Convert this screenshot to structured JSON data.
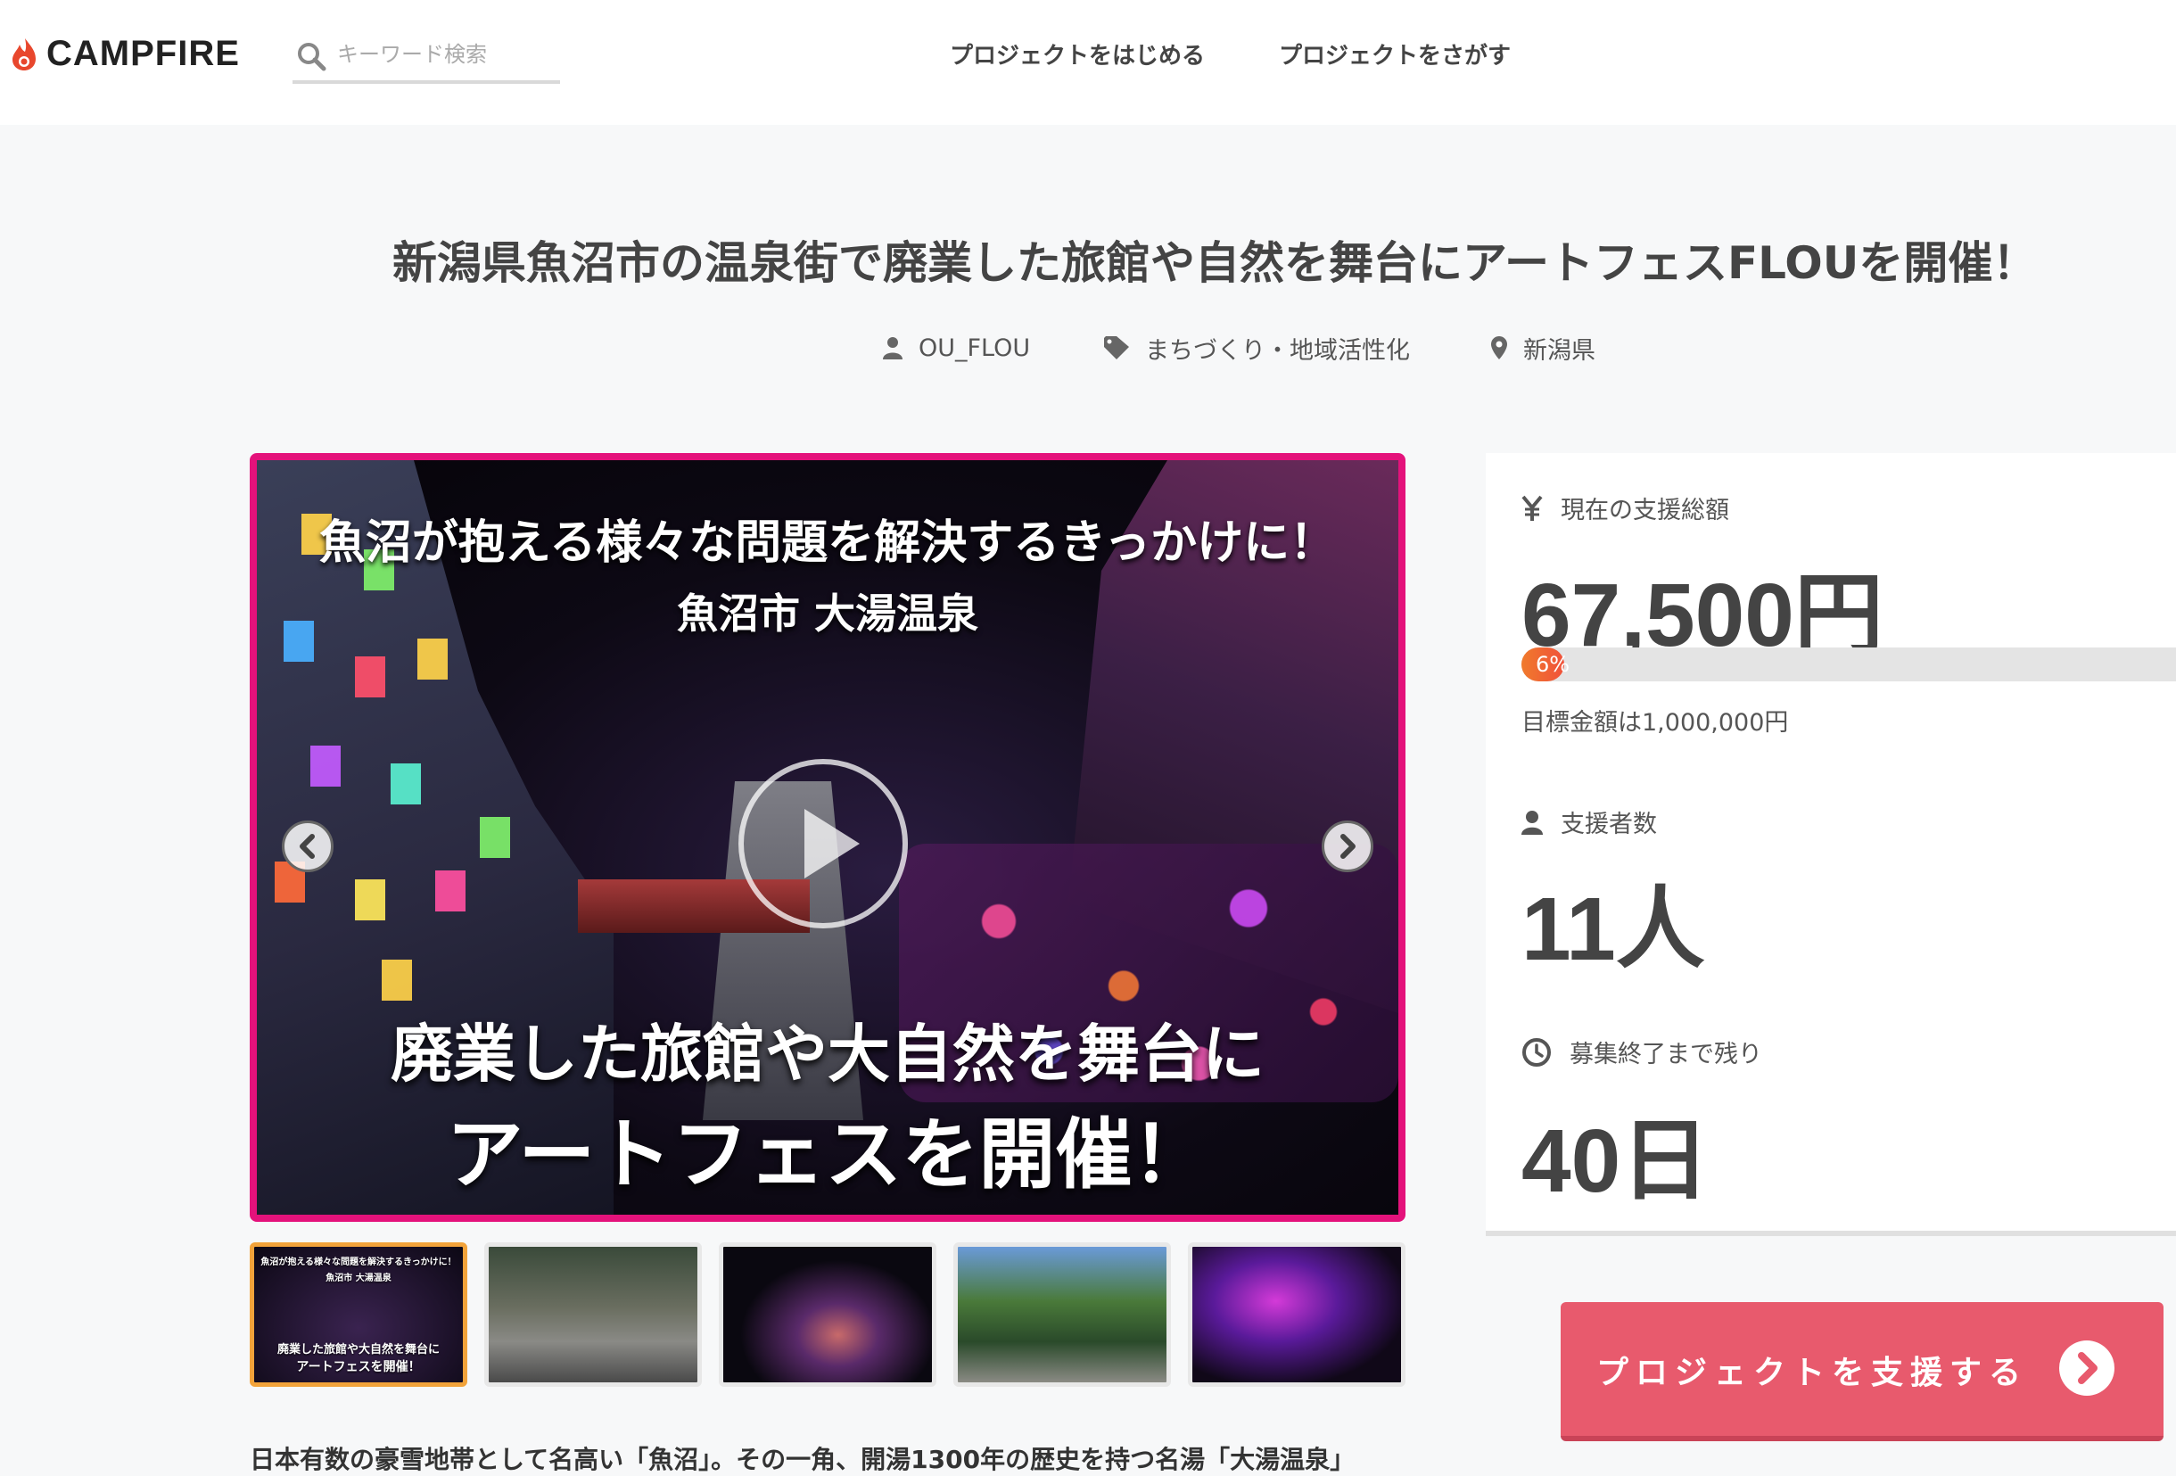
{
  "header": {
    "logo_text": "CAMPFIRE",
    "search_placeholder": "キーワード検索",
    "nav_start": "プロジェクトをはじめる",
    "nav_find": "プロジェクトをさがす"
  },
  "project": {
    "title": "新潟県魚沼市の温泉街で廃業した旅館や自然を舞台にアートフェスFLOUを開催！",
    "owner": "OU_FLOU",
    "category": "まちづくり・地域活性化",
    "location": "新潟県"
  },
  "main_visual": {
    "heading": "魚沼が抱える様々な問題を解決するきっかけに！",
    "subheading": "魚沼市 大湯温泉",
    "caption_line1": "廃業した旅館や大自然を舞台に",
    "caption_line2": "アートフェスを開催！"
  },
  "thumbnails": [
    {
      "caption_small": "魚沼が抱える様々な問題を解決するきっかけに！",
      "caption_sub": "魚沼市 大湯温泉",
      "caption_main1": "廃業した旅館や大自然を舞台に",
      "caption_main2": "アートフェスを開催！",
      "active": true
    },
    {
      "active": false
    },
    {
      "active": false
    },
    {
      "active": false
    },
    {
      "active": false
    }
  ],
  "stats": {
    "funding_label": "現在の支援総額",
    "funding_amount": "67,500円",
    "progress_percent": 6,
    "progress_text": "6%",
    "goal_text": "目標金額は1,000,000円",
    "supporters_label": "支援者数",
    "supporters_value": "11人",
    "remaining_label": "募集終了まで残り",
    "remaining_value": "40日"
  },
  "support_button_label": "プロジェクトを支援する",
  "description_start": "日本有数の豪雪地帯として名高い「魚沼」。その一角、開湯1300年の歴史を持つ名湯「大湯温泉」",
  "colors": {
    "accent_pink": "#e4127b",
    "support_button": "#e85a6d",
    "progress": "#f0513a"
  },
  "icons": {
    "owner": "user-icon",
    "category": "tag-icon",
    "location": "map-pin-icon",
    "funding": "yen-icon",
    "supporters": "user-icon",
    "remaining": "clock-icon"
  }
}
